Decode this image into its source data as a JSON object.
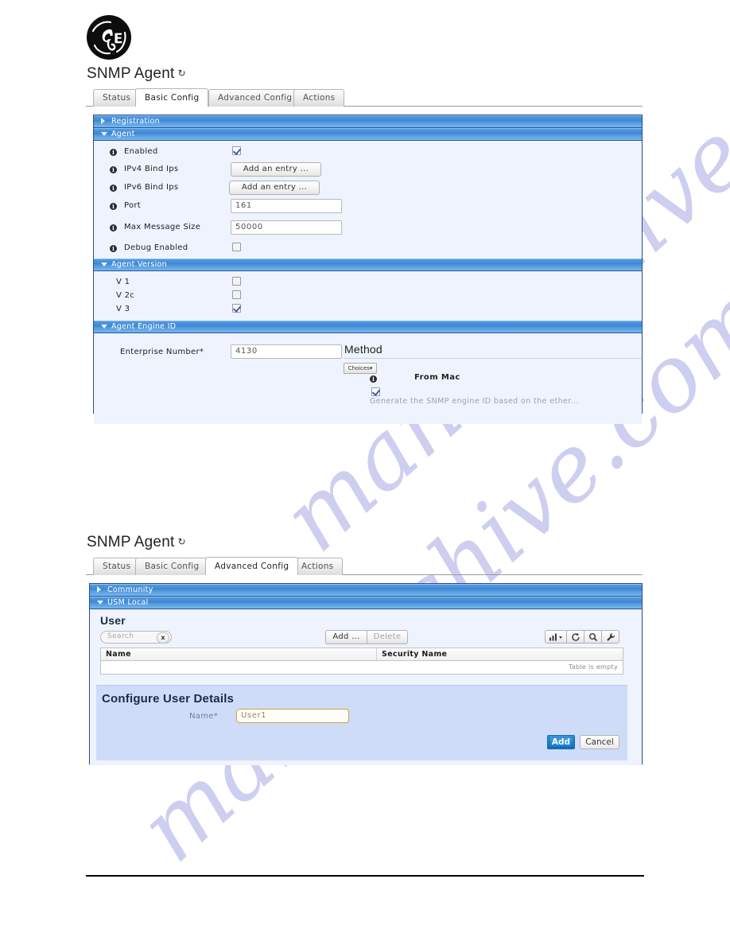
{
  "brand": {
    "logo": "ge-monogram-logo"
  },
  "watermark": {
    "text": "manualshive.com"
  },
  "sections": [
    {
      "id": "basic",
      "title": "SNMP Agent",
      "refresh_glyph": "↻",
      "tabs": [
        {
          "label": "Status",
          "active": false
        },
        {
          "label": "Basic Config",
          "active": true
        },
        {
          "label": "Advanced Config",
          "active": false
        },
        {
          "label": "Actions",
          "active": false
        }
      ],
      "panels": {
        "registration": {
          "label": "Registration",
          "expanded": false
        },
        "agent": {
          "label": "Agent",
          "expanded": true,
          "fields": [
            {
              "label": "Enabled",
              "type": "checkbox",
              "checked": true,
              "info": true
            },
            {
              "label": "IPv4 Bind Ips",
              "type": "button",
              "value": "Add an entry ...",
              "info": true
            },
            {
              "label": "IPv6 Bind Ips",
              "type": "button",
              "value": "Add an entry ...",
              "info": true
            },
            {
              "label": "Port",
              "type": "text",
              "value": "161",
              "info": true
            },
            {
              "label": "Max Message Size",
              "type": "text",
              "value": "50000",
              "info": true
            },
            {
              "label": "Debug Enabled",
              "type": "checkbox",
              "checked": false,
              "info": true
            }
          ]
        },
        "agent_version": {
          "label": "Agent Version",
          "expanded": true,
          "fields": [
            {
              "label": "V 1",
              "type": "checkbox",
              "checked": false
            },
            {
              "label": "V 2c",
              "type": "checkbox",
              "checked": false
            },
            {
              "label": "V 3",
              "type": "checkbox",
              "checked": true
            }
          ]
        },
        "agent_engine_id": {
          "label": "Agent Engine ID",
          "expanded": true,
          "enterprise_number_label": "Enterprise Number*",
          "enterprise_number_value": "4130",
          "method_title": "Method",
          "choices_button": "Choices",
          "method_option": "From Mac",
          "method_checked": true,
          "method_description": "Generate the SNMP engine ID based on the ether..."
        }
      }
    },
    {
      "id": "advanced",
      "title": "SNMP Agent",
      "refresh_glyph": "↻",
      "tabs": [
        {
          "label": "Status",
          "active": false
        },
        {
          "label": "Basic Config",
          "active": false
        },
        {
          "label": "Advanced Config",
          "active": true
        },
        {
          "label": "Actions",
          "active": false
        }
      ],
      "panels": {
        "community": {
          "label": "Community",
          "expanded": false
        },
        "usm_local": {
          "label": "USM Local",
          "expanded": true,
          "widget_title": "User",
          "search_placeholder": "Search",
          "clear_label": "x",
          "add_button": "Add ...",
          "delete_button": "Delete",
          "toolbar_icons": [
            "chart-dropdown-icon",
            "refresh-icon",
            "search-icon",
            "wrench-icon"
          ],
          "columns": [
            "Name",
            "Security Name"
          ],
          "rows": [],
          "empty_text": "Table is empty",
          "detail": {
            "title": "Configure User Details",
            "name_label": "Name*",
            "name_value": "User1",
            "submit_label": "Add",
            "cancel_label": "Cancel"
          }
        }
      }
    }
  ]
}
